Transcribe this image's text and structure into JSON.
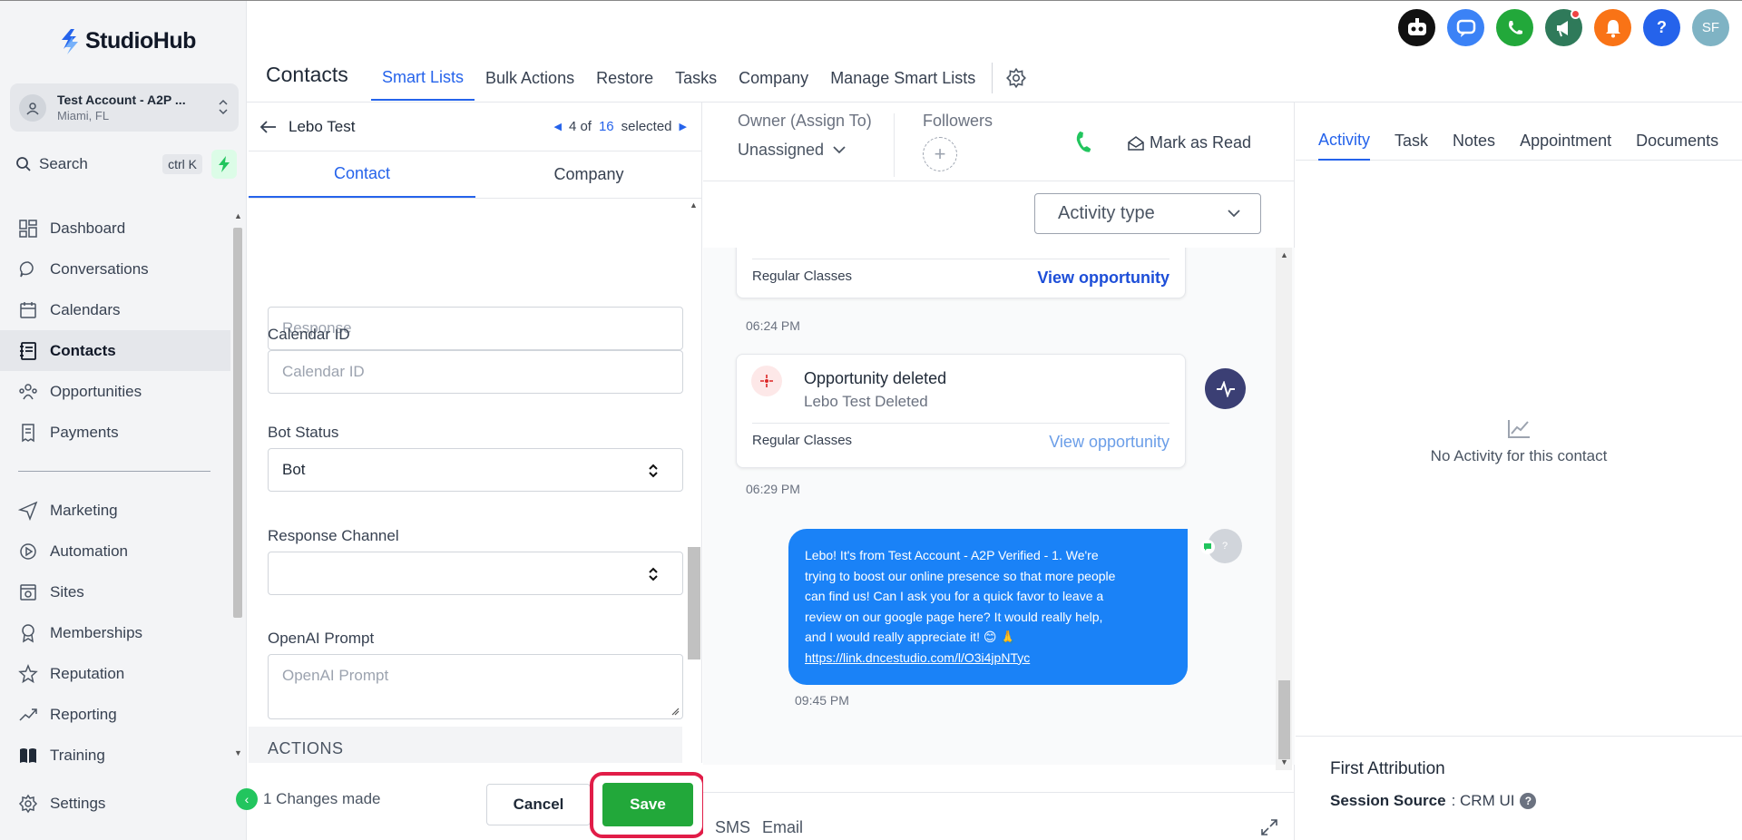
{
  "brand": {
    "name": "StudioHub"
  },
  "account": {
    "name": "Test Account - A2P ...",
    "location": "Miami, FL"
  },
  "search": {
    "label": "Search",
    "shortcut": "ctrl K"
  },
  "sidebar": {
    "items": [
      {
        "label": "Dashboard",
        "icon": "grid-icon"
      },
      {
        "label": "Conversations",
        "icon": "chat-icon"
      },
      {
        "label": "Calendars",
        "icon": "calendar-icon"
      },
      {
        "label": "Contacts",
        "icon": "contact-book-icon",
        "active": true
      },
      {
        "label": "Opportunities",
        "icon": "funnel-icon"
      },
      {
        "label": "Payments",
        "icon": "receipt-icon"
      }
    ],
    "items2": [
      {
        "label": "Marketing",
        "icon": "send-icon"
      },
      {
        "label": "Automation",
        "icon": "play-circle-icon"
      },
      {
        "label": "Sites",
        "icon": "globe-icon"
      },
      {
        "label": "Memberships",
        "icon": "badge-icon"
      },
      {
        "label": "Reputation",
        "icon": "star-icon"
      },
      {
        "label": "Reporting",
        "icon": "trend-icon"
      },
      {
        "label": "Training",
        "icon": "book-icon"
      }
    ],
    "settings": "Settings"
  },
  "topbar": {
    "icons": [
      {
        "name": "bot-icon",
        "color": "#111111"
      },
      {
        "name": "chat-bubble-icon",
        "color": "#3b82f6"
      },
      {
        "name": "phone-icon",
        "color": "#22a83a"
      },
      {
        "name": "megaphone-icon",
        "color": "#2f7a5a"
      },
      {
        "name": "bell-icon",
        "color": "#f97316"
      },
      {
        "name": "help-icon",
        "color": "#2563eb",
        "text": "?"
      },
      {
        "name": "user-avatar",
        "color": "#7fb3c4",
        "text": "SF"
      }
    ],
    "title": "Contacts",
    "tabs": [
      "Smart Lists",
      "Bulk Actions",
      "Restore",
      "Tasks",
      "Company",
      "Manage Smart Lists"
    ]
  },
  "contact": {
    "name": "Lebo Test",
    "pager": {
      "current": "4 of",
      "total": "16",
      "suffix": "selected"
    },
    "tabs": [
      "Contact",
      "Company"
    ],
    "fields": {
      "response_placeholder": "Response",
      "calendar_label": "Calendar ID",
      "calendar_placeholder": "Calendar ID",
      "bot_label": "Bot Status",
      "bot_value": "Bot",
      "channel_label": "Response Channel",
      "channel_value": "",
      "prompt_label": "OpenAI Prompt",
      "prompt_placeholder": "OpenAI Prompt"
    },
    "actions_heading": "ACTIONS",
    "changes": "1 Changes made",
    "cancel": "Cancel",
    "save": "Save"
  },
  "conversation": {
    "owner_label": "Owner (Assign To)",
    "owner_value": "Unassigned",
    "followers_label": "Followers",
    "mark_read": "Mark as Read",
    "activity_type": "Activity type",
    "card1": {
      "tag": "Regular Classes",
      "link": "View opportunity",
      "time": "06:24 PM"
    },
    "card2": {
      "title": "Opportunity deleted",
      "subtitle": "Lebo Test Deleted",
      "tag": "Regular Classes",
      "link": "View opportunity",
      "time": "06:29 PM"
    },
    "message": {
      "lines": [
        "Lebo! It's  from Test Account - A2P Verified - 1. We're",
        "trying to boost our online presence so that more people",
        "can find us! Can I ask you for a quick favor to leave a",
        "review on our google page here? It would really help,",
        "and I would really appreciate it! 😊 🙏"
      ],
      "link": "https://link.dncestudio.com/l/O3i4jpNTyc",
      "time": "09:45 PM",
      "avatar_text": "?"
    },
    "compose_tabs": [
      "SMS",
      "Email"
    ]
  },
  "right": {
    "tabs": [
      "Activity",
      "Task",
      "Notes",
      "Appointment",
      "Documents"
    ],
    "empty": "No Activity for this contact",
    "attribution_title": "First Attribution",
    "session_key": "Session Source",
    "session_value": ": CRM UI"
  },
  "colors": {
    "accent": "#2563eb",
    "save": "#22a83a",
    "highlight": "#e11d48",
    "message": "#1a82f7"
  }
}
